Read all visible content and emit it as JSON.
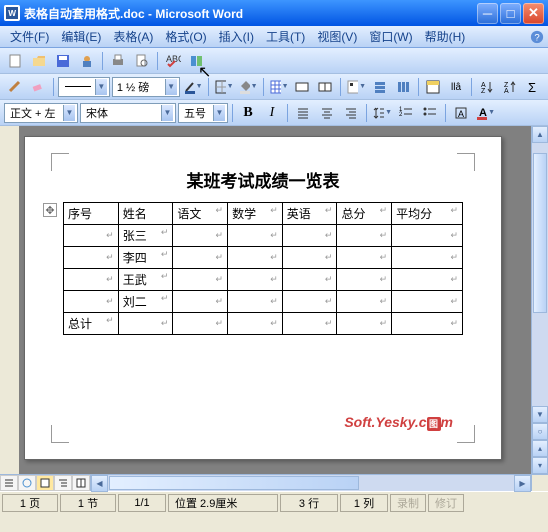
{
  "titlebar": {
    "text": "表格自动套用格式.doc - Microsoft Word"
  },
  "menu": {
    "file": "文件(F)",
    "edit": "编辑(E)",
    "table": "表格(A)",
    "format": "格式(O)",
    "insert": "插入(I)",
    "tools": "工具(T)",
    "view": "视图(V)",
    "window": "窗口(W)",
    "help": "帮助(H)"
  },
  "format_bar": {
    "style": "正文 + 左",
    "font": "宋体",
    "size": "五号",
    "zoom": "1 ½ 磅"
  },
  "document": {
    "title": "某班考试成绩一览表",
    "headers": [
      "序号",
      "姓名",
      "语文",
      "数学",
      "英语",
      "总分",
      "平均分"
    ],
    "rows": [
      [
        "",
        "张三",
        "",
        "",
        "",
        "",
        ""
      ],
      [
        "",
        "李四",
        "",
        "",
        "",
        "",
        ""
      ],
      [
        "",
        "王武",
        "",
        "",
        "",
        "",
        ""
      ],
      [
        "",
        "刘二",
        "",
        "",
        "",
        "",
        ""
      ],
      [
        "总计",
        "",
        "",
        "",
        "",
        "",
        ""
      ]
    ],
    "watermark": "Soft.Yesky.c",
    "watermark_suffix": "m",
    "watermark_tu": "图"
  },
  "status": {
    "page": "1 页",
    "sec": "1 节",
    "pages": "1/1",
    "pos": "位置 2.9厘米",
    "line": "3 行",
    "col": "1 列",
    "rec": "录制",
    "rev": "修订"
  }
}
